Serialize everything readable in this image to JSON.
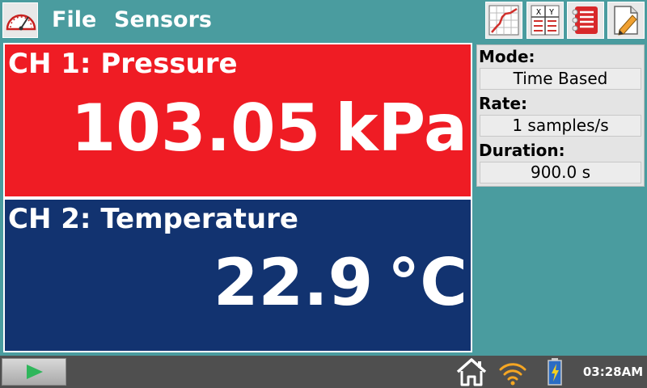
{
  "menu": {
    "file": "File",
    "sensors": "Sensors"
  },
  "toolbar": {
    "icons": [
      "meter-view-icon",
      "graph-view-icon",
      "table-view-icon",
      "notes-icon",
      "journal-icon"
    ]
  },
  "channels": [
    {
      "label": "CH 1: Pressure",
      "value": "103.05",
      "unit": "kPa",
      "color": "#ef1c24"
    },
    {
      "label": "CH 2: Temperature",
      "value": "22.9",
      "unit": "°C",
      "color": "#123370"
    }
  ],
  "settings": {
    "mode_label": "Mode:",
    "mode_value": "Time Based",
    "rate_label": "Rate:",
    "rate_value": "1 samples/s",
    "duration_label": "Duration:",
    "duration_value": "900.0 s"
  },
  "status": {
    "time": "03:28AM",
    "icons": [
      "play-icon",
      "home-icon",
      "wifi-icon",
      "battery-icon"
    ]
  },
  "colors": {
    "background": "#4a9c9f",
    "status_bar": "#4f4f4f",
    "play_arrow": "#2fb65b"
  }
}
